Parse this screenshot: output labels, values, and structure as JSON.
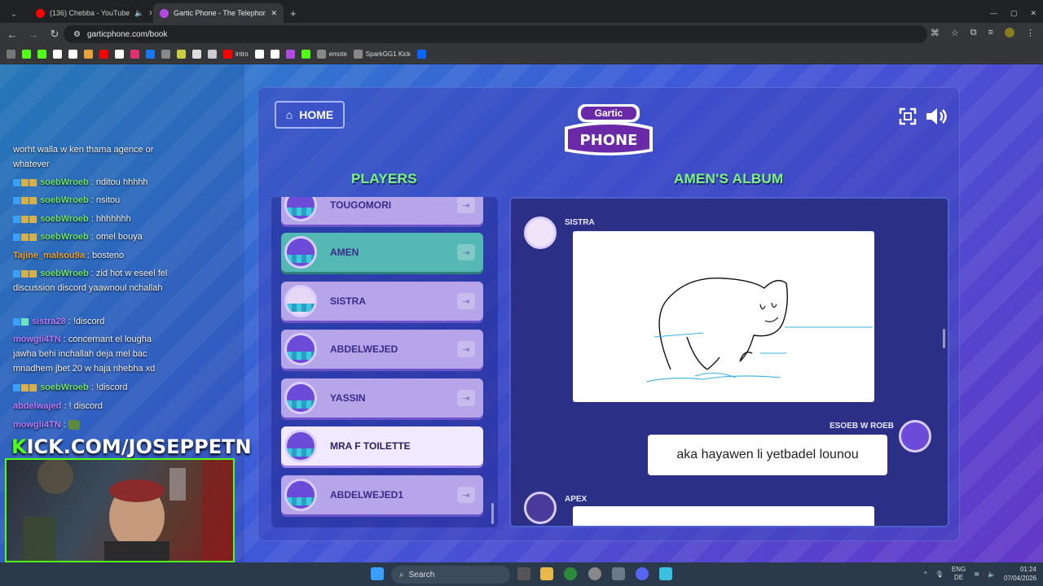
{
  "browser": {
    "tabs": [
      {
        "title": "(136) Chebba - YouTube",
        "icon": "youtube-icon",
        "color": "#ff0000"
      },
      {
        "title": "Gartic Phone - The Telephone G",
        "icon": "gartic-icon",
        "color": "#b04ae0"
      }
    ],
    "url": "garticphone.com/book",
    "bookmarks": [
      {
        "label": "",
        "color": "#53fc18"
      },
      {
        "label": "",
        "color": "#53fc18"
      },
      {
        "label": "",
        "color": "#ffffff"
      },
      {
        "label": "",
        "color": "#ffffff"
      },
      {
        "label": "",
        "color": "#e8a33a"
      },
      {
        "label": "",
        "color": "#ff0000"
      },
      {
        "label": "",
        "color": "#ffffff"
      },
      {
        "label": "",
        "color": "#e1306c"
      },
      {
        "label": "",
        "color": "#1877f2"
      },
      {
        "label": "",
        "color": "#888888"
      },
      {
        "label": "",
        "color": "#cccc44"
      },
      {
        "label": "",
        "color": "#dddddd"
      },
      {
        "label": "",
        "color": "#cccccc"
      },
      {
        "label": "intro",
        "color": "#ff0000"
      },
      {
        "label": "",
        "color": "#ffffff"
      },
      {
        "label": "",
        "color": "#ffffff"
      },
      {
        "label": "",
        "color": "#b04ae0"
      },
      {
        "label": "",
        "color": "#53fc18"
      },
      {
        "label": "emote",
        "color": "#888888"
      },
      {
        "label": "SparkGG1 Kick",
        "color": "#888888"
      },
      {
        "label": "",
        "color": "#0866ff"
      }
    ]
  },
  "chat": {
    "messages": [
      {
        "user": "",
        "text": "worht walla w ken thama agence or whatever",
        "style": "none"
      },
      {
        "user": "soebWroeb",
        "text": " : nditou hhhhh",
        "style": "u"
      },
      {
        "user": "soebWroeb",
        "text": " : nsitou",
        "style": "u"
      },
      {
        "user": "soebWroeb",
        "text": " : hhhhhhh",
        "style": "u"
      },
      {
        "user": "soebWroeb",
        "text": " : omel bouya",
        "style": "u"
      },
      {
        "user": "Tajine_malsou9a",
        "text": " : bosteno",
        "style": "u2"
      },
      {
        "user": "soebWroeb",
        "text": " : zid hot w eseel fel discussion discord yaawnoul nchallah",
        "style": "u"
      },
      {
        "user": "sistra28",
        "text": " : !discord",
        "style": "u3"
      },
      {
        "user": "mowgli4TN",
        "text": " : concernant el lougha jawha behi inchallah deja mel bac mnadhem jbet 20 w haja nhebha xd",
        "style": "u3"
      },
      {
        "user": "soebWroeb",
        "text": " : !discord",
        "style": "u"
      },
      {
        "user": "abdelwajed",
        "text": " : ! discord",
        "style": "u3"
      },
      {
        "user": "mowgli4TN",
        "text": " :",
        "style": "u3"
      }
    ],
    "kick_prefix": "K",
    "kick_text": "ICK.COM/JOSEPPETN"
  },
  "game": {
    "home_label": "HOME",
    "logo_top": "Gartic",
    "logo_bottom": "PHONE",
    "players_title": "PLAYERS",
    "album_title": "AMEN'S ALBUM",
    "players": [
      {
        "name": "TOUGOMORI",
        "style": "normal"
      },
      {
        "name": "AMEN",
        "style": "teal"
      },
      {
        "name": "SISTRA",
        "style": "normal"
      },
      {
        "name": "ABDELWEJED",
        "style": "normal"
      },
      {
        "name": "YASSIN",
        "style": "normal"
      },
      {
        "name": "MRA F TOILETTE",
        "style": "hl"
      },
      {
        "name": "ABDELWEJED1",
        "style": "normal"
      }
    ],
    "album": {
      "drawer": "SISTRA",
      "guesser": "ESOEB W ROEB",
      "guess_text": "aka hayawen li yetbadel lounou",
      "next_player": "APEX"
    }
  },
  "taskbar": {
    "search_label": "Search",
    "lang_top": "ENG",
    "lang_bottom": "DE",
    "time": "01:24",
    "date": "07/04/2026"
  }
}
